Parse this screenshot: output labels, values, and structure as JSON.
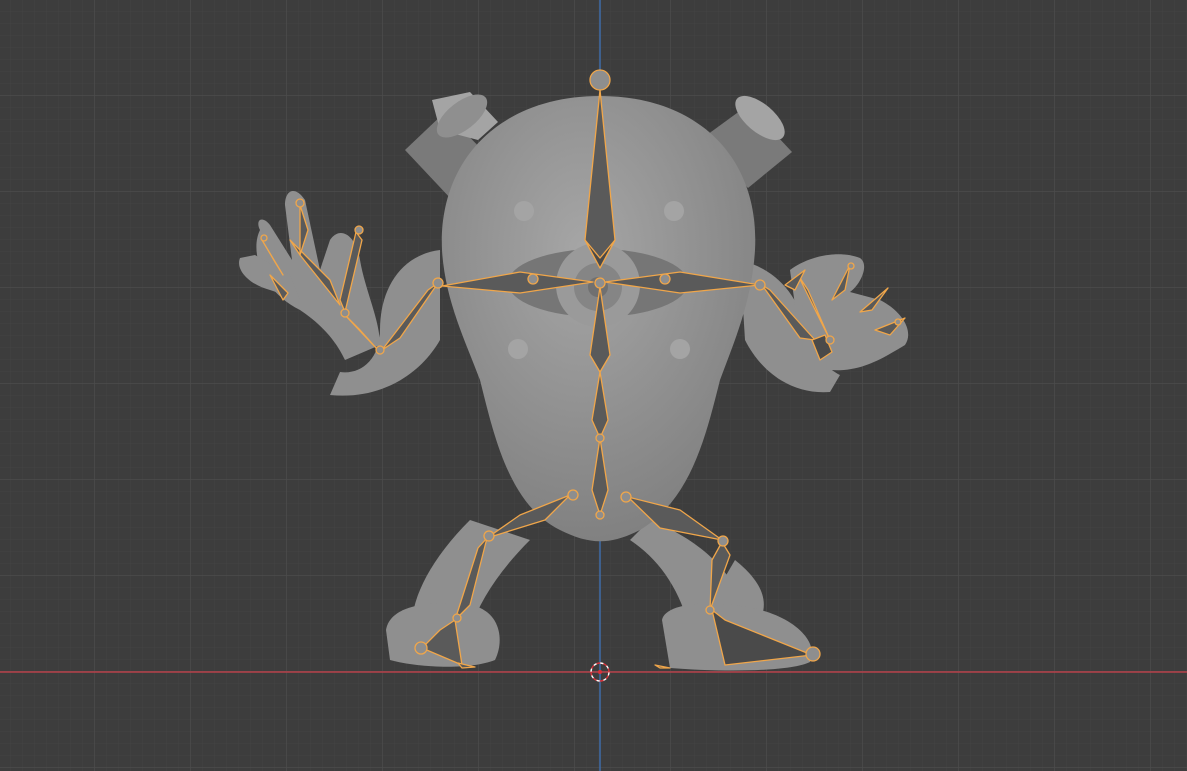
{
  "viewport": {
    "background_color": "#3d3d3d",
    "grid_minor_color": "#444444",
    "grid_major_color": "#4c4c4c",
    "x_axis_color": "#b6404a",
    "z_axis_color": "#3f6fb0",
    "bone_outline_color": "#f0a64a",
    "mesh_color": "#8f8f8f"
  },
  "scene": {
    "mesh": "character-mesh",
    "armature": "armature-rig",
    "cursor": "3d-cursor-icon"
  }
}
